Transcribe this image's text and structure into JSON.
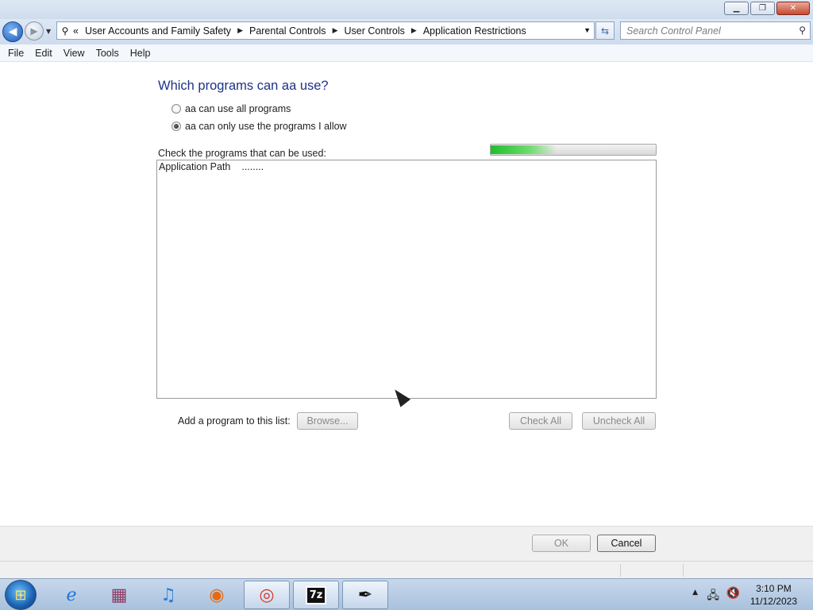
{
  "window": {
    "minimize_glyph": "▁",
    "maximize_glyph": "❐",
    "close_glyph": "✕"
  },
  "nav": {
    "back_glyph": "◀",
    "forward_glyph": "▶",
    "breadcrumb_prefix": "«",
    "breadcrumbs": [
      "User Accounts and Family Safety",
      "Parental Controls",
      "User Controls",
      "Application Restrictions"
    ],
    "search_placeholder": "Search Control Panel"
  },
  "menu": {
    "items": [
      "File",
      "Edit",
      "View",
      "Tools",
      "Help"
    ]
  },
  "content": {
    "heading": "Which programs can aa use?",
    "radio_all": "aa can use all programs",
    "radio_only": "aa can only use the programs I allow",
    "selected_option": "radio_only",
    "check_label": "Check the programs that can be used:",
    "progress_fraction": 0.4,
    "list_header": "Application Path",
    "list_loading": "........",
    "add_label": "Add a program to this list:",
    "browse": "Browse...",
    "check_all": "Check All",
    "uncheck_all": "Uncheck All"
  },
  "footer": {
    "ok": "OK",
    "cancel": "Cancel"
  },
  "taskbar": {
    "apps": [
      "internet-explorer",
      "winrar",
      "itunes",
      "firefox",
      "chrome",
      "7zip",
      "paint"
    ],
    "time": "3:10 PM",
    "date": "11/12/2023"
  },
  "colors": {
    "heading": "#1e3287",
    "accent": "#1c5bb8",
    "progress": "#1fbe2c"
  }
}
